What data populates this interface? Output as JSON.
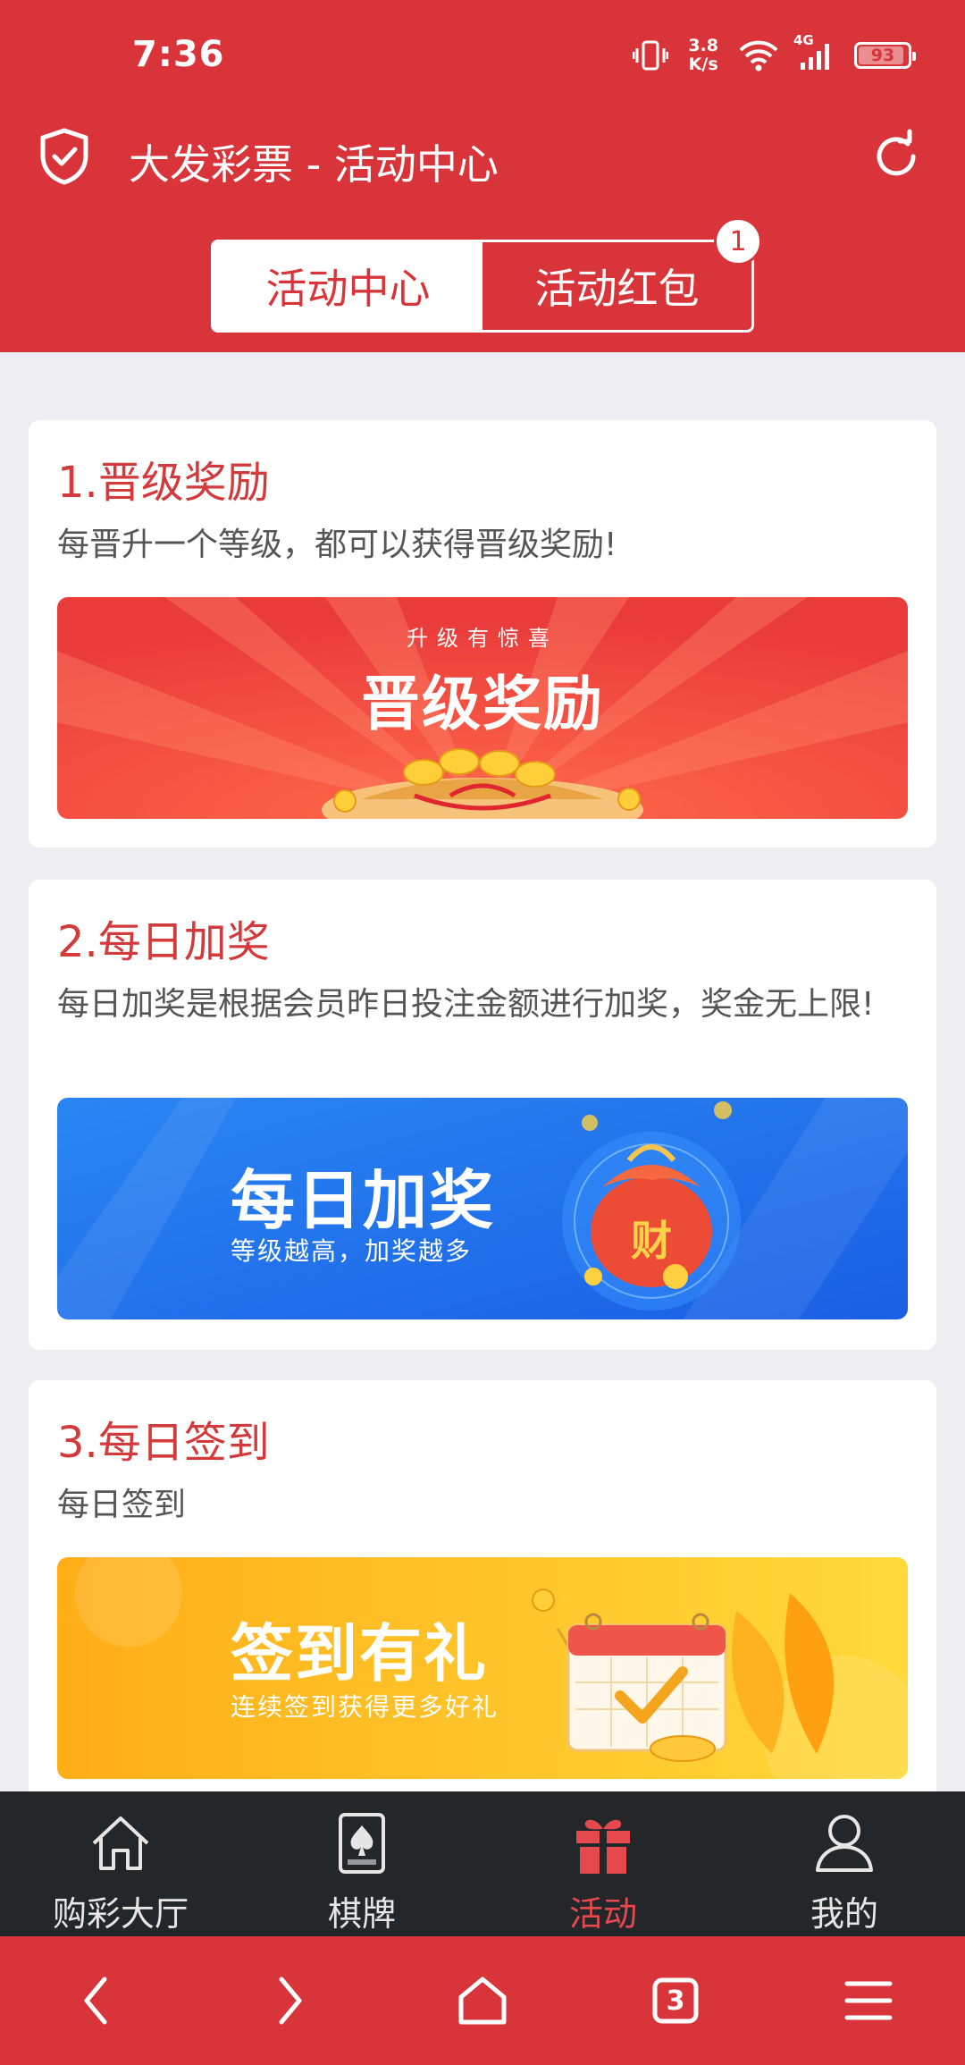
{
  "status_bar": {
    "time": "7:36",
    "net_speed_value": "3.8",
    "net_speed_unit": "K/s",
    "network_type": "4G",
    "battery": "93",
    "battery_fraction": 0.93
  },
  "app_bar": {
    "title": "大发彩票 - 活动中心"
  },
  "tabs": [
    {
      "label": "活动中心",
      "active": true
    },
    {
      "label": "活动红包",
      "active": false,
      "badge": "1"
    }
  ],
  "activities": [
    {
      "title": "1.晋级奖励",
      "description": "每晋升一个等级，都可以获得晋级奖励!",
      "banner": {
        "tagline": "升级有惊喜",
        "heading": "晋级奖励",
        "subtitle": ""
      }
    },
    {
      "title": "2.每日加奖",
      "description": "每日加奖是根据会员昨日投注金额进行加奖，奖金无上限!",
      "banner": {
        "heading": "每日加奖",
        "subtitle": "等级越高，加奖越多",
        "badge_char": "财"
      }
    },
    {
      "title": "3.每日签到",
      "description": "每日签到",
      "banner": {
        "heading": "签到有礼",
        "subtitle": "连续签到获得更多好礼"
      }
    }
  ],
  "bottom_nav": [
    {
      "label": "购彩大厅",
      "icon": "home-icon",
      "active": false
    },
    {
      "label": "棋牌",
      "icon": "card-spade-icon",
      "active": false
    },
    {
      "label": "活动",
      "icon": "gift-icon",
      "active": true
    },
    {
      "label": "我的",
      "icon": "user-icon",
      "active": false
    }
  ],
  "browser_bar": {
    "tab_count": "3"
  },
  "colors": {
    "primary_red": "#d8343a",
    "title_red": "#d23a3c",
    "nav_dark": "#23272a",
    "active_nav": "#e5484d",
    "page_bg": "#ededf2"
  }
}
